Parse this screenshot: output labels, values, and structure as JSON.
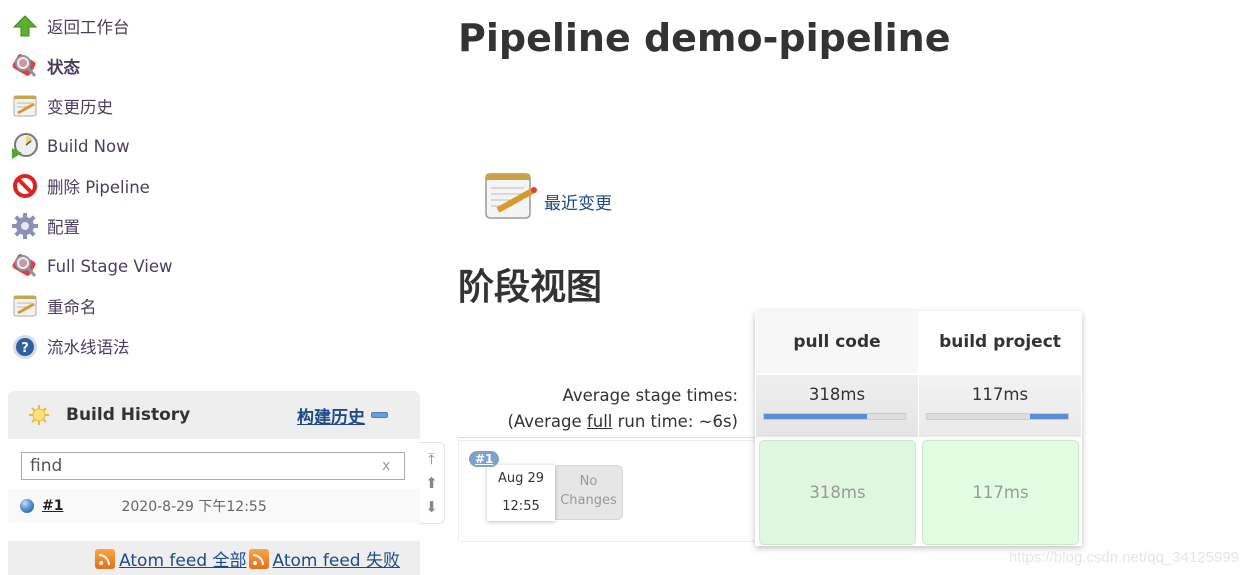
{
  "sidebar": {
    "items": [
      {
        "label": "返回工作台",
        "icon": "up-arrow-icon"
      },
      {
        "label": "状态",
        "icon": "magnifier-icon",
        "active": true
      },
      {
        "label": "变更历史",
        "icon": "notepad-icon"
      },
      {
        "label": "Build Now",
        "icon": "clock-play-icon"
      },
      {
        "label": "删除 Pipeline",
        "icon": "no-entry-icon"
      },
      {
        "label": "配置",
        "icon": "gear-icon"
      },
      {
        "label": "Full Stage View",
        "icon": "magnifier-icon"
      },
      {
        "label": "重命名",
        "icon": "notepad-icon"
      },
      {
        "label": "流水线语法",
        "icon": "help-icon"
      }
    ]
  },
  "build_history": {
    "title": "Build History",
    "link": "构建历史",
    "search_value": "find",
    "clear_label": "x",
    "builds": [
      {
        "number": "#1",
        "date": "2020-8-29 下午12:55"
      }
    ],
    "feeds": [
      "Atom feed 全部",
      "Atom feed 失败"
    ]
  },
  "main": {
    "title": "Pipeline demo-pipeline",
    "recent_changes": "最近变更",
    "stage_view_title": "阶段视图"
  },
  "stage_view": {
    "avg_label": "Average stage times:",
    "avg_full_prefix": "(Average ",
    "avg_full_link": "full",
    "avg_full_suffix": " run time: ~6s)",
    "stages": [
      {
        "name": "pull code",
        "avg": "318ms",
        "bar_start": 0,
        "bar_fraction": 0.73
      },
      {
        "name": "build project",
        "avg": "117ms",
        "bar_start": 0.73,
        "bar_fraction": 0.27
      }
    ],
    "runs": [
      {
        "badge": "#1",
        "date": "Aug 29",
        "time": "12:55",
        "changes_line1": "No",
        "changes_line2": "Changes",
        "durations": [
          "318ms",
          "117ms"
        ],
        "status_color": "#def7de"
      }
    ]
  },
  "watermark": "https://blog.csdn.net/qq_34125999"
}
